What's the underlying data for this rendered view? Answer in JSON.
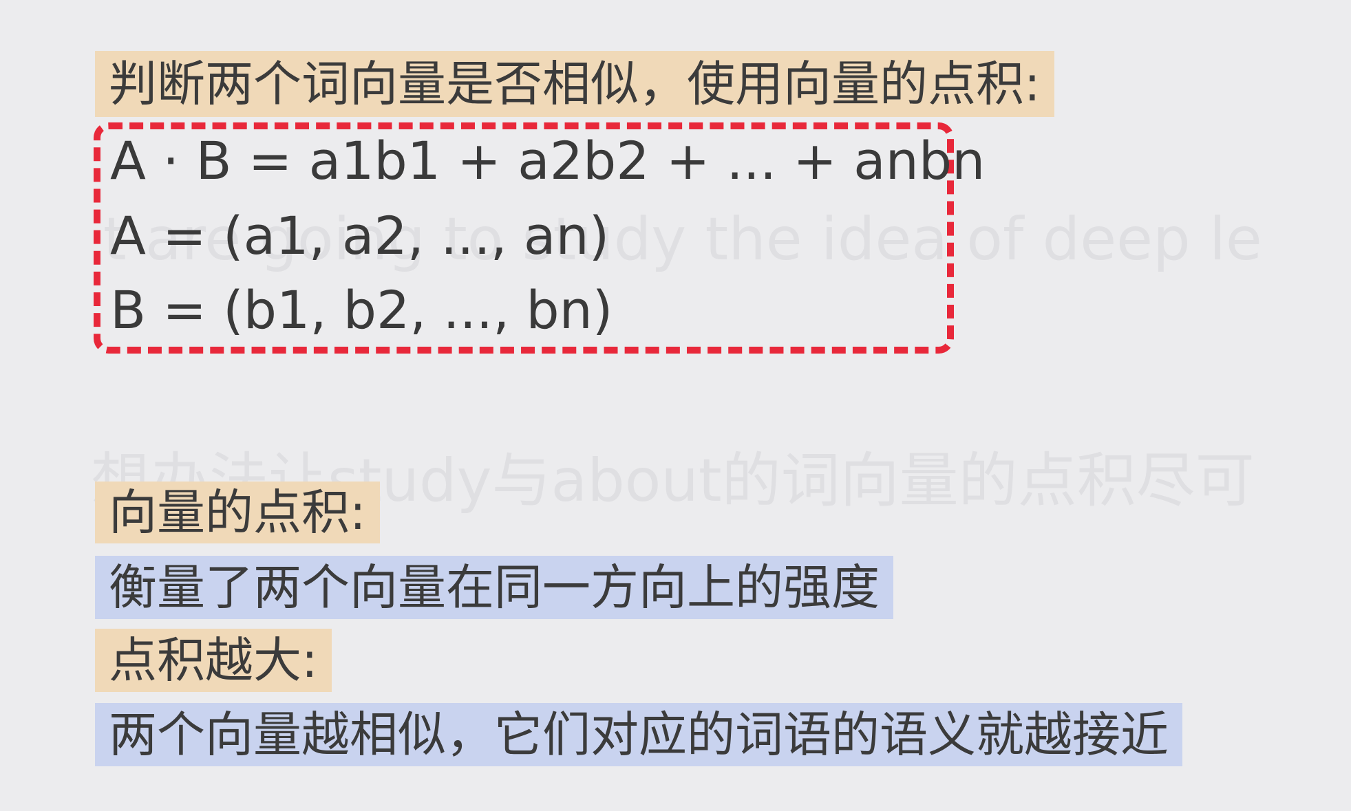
{
  "background_text": {
    "line_1": "t are going to study the idea of deep le",
    "line_2": "想办法让study与about的词向量的点积尽可"
  },
  "heading": "判断两个词向量是否相似，使用向量的点积:",
  "formulas": [
    "A · B = a1b1 + a2b2 + ... + anbn",
    "A = (a1, a2, ..., an)",
    "B = (b1, b2, ..., bn)"
  ],
  "sections": {
    "dot_product_title": "向量的点积:",
    "dot_product_desc": "衡量了两个向量在同一方向上的强度",
    "larger_title": "点积越大:",
    "larger_desc": "两个向量越相似，它们对应的词语的语义就越接近"
  },
  "colors": {
    "highlight_orange": "#f0d9b8",
    "highlight_blue": "#c9d3ef",
    "box_border": "#e8283a",
    "background": "#ececee"
  }
}
